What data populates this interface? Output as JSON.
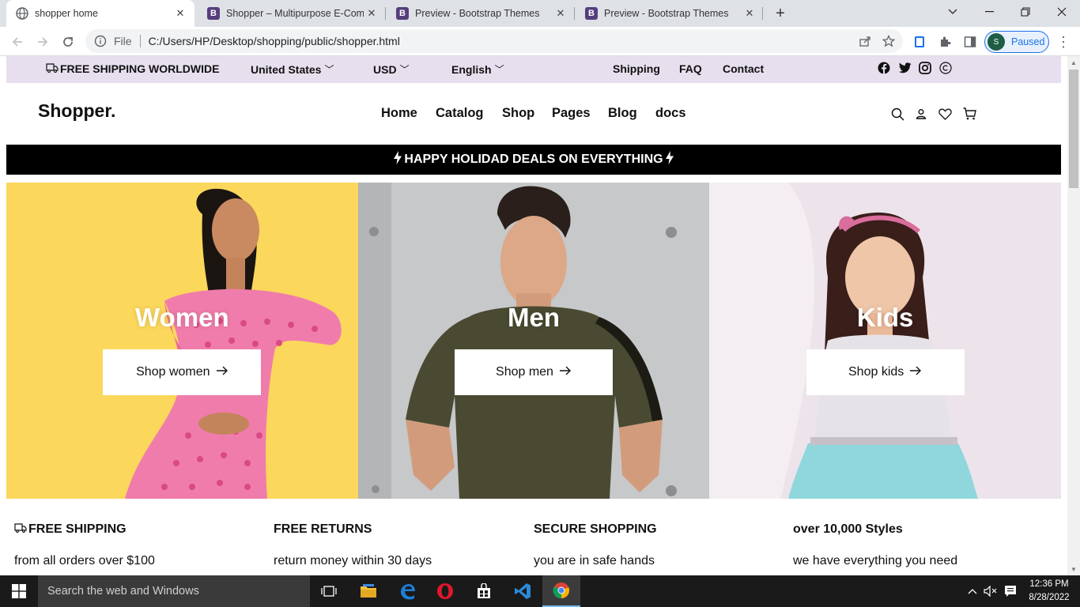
{
  "browser": {
    "tabs": [
      {
        "title": "shopper home",
        "favicon": "globe-icon",
        "active": true
      },
      {
        "title": "Shopper – Multipurpose E-Comm",
        "favicon": "bootstrap-icon",
        "active": false
      },
      {
        "title": "Preview - Bootstrap Themes",
        "favicon": "bootstrap-icon",
        "active": false
      },
      {
        "title": "Preview - Bootstrap Themes",
        "favicon": "bootstrap-icon",
        "active": false
      }
    ],
    "address": {
      "scheme_label": "File",
      "url": "C:/Users/HP/Desktop/shopping/public/shopper.html"
    },
    "profile": {
      "initial": "S",
      "status": "Paused"
    }
  },
  "topbar": {
    "shipping_notice": "FREE SHIPPING WORLDWIDE",
    "country": "United States",
    "currency": "USD",
    "language": "English",
    "links": [
      "Shipping",
      "FAQ",
      "Contact"
    ],
    "social": [
      "facebook-icon",
      "twitter-icon",
      "instagram-icon",
      "copyright-icon"
    ]
  },
  "header": {
    "logo": "Shopper.",
    "nav": [
      "Home",
      "Catalog",
      "Shop",
      "Pages",
      "Blog",
      "docs"
    ]
  },
  "promo": {
    "text": "HAPPY HOLIDAD DEALS ON EVERYTHING"
  },
  "categories": [
    {
      "title": "Women",
      "button": "Shop women",
      "bg": "#fbd75c"
    },
    {
      "title": "Men",
      "button": "Shop men",
      "bg": "#c4c6c8"
    },
    {
      "title": "Kids",
      "button": "Shop kids",
      "bg": "#ece3ea"
    }
  ],
  "features": [
    {
      "title": "FREE SHIPPING",
      "subtitle": "from all orders over $100"
    },
    {
      "title": "FREE RETURNS",
      "subtitle": "return money within 30 days"
    },
    {
      "title": "SECURE SHOPPING",
      "subtitle": "you are in safe hands"
    },
    {
      "title": "over 10,000 Styles",
      "subtitle": "we have everything you need"
    }
  ],
  "taskbar": {
    "search_placeholder": "Search the web and Windows",
    "time": "12:36 PM",
    "date": "8/28/2022"
  },
  "colors": {
    "topbar_bg": "#e7dfee",
    "promo_bg": "#000000",
    "accent": "#1a73e8"
  }
}
